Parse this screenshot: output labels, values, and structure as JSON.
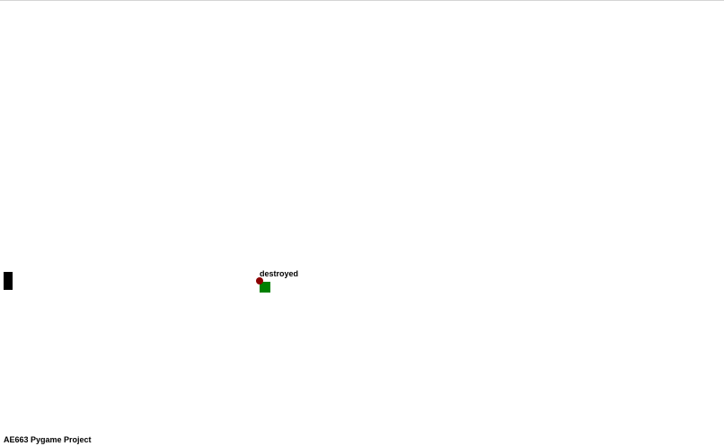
{
  "game": {
    "status_text": "destroyed",
    "footer_caption": "AE663 Pygame Project"
  },
  "colors": {
    "player": "#000000",
    "projectile": "#8b0000",
    "target": "#008000",
    "background": "#ffffff"
  },
  "icons": {
    "player": "player-paddle-icon",
    "projectile": "projectile-ball-icon",
    "target": "target-block-icon"
  }
}
